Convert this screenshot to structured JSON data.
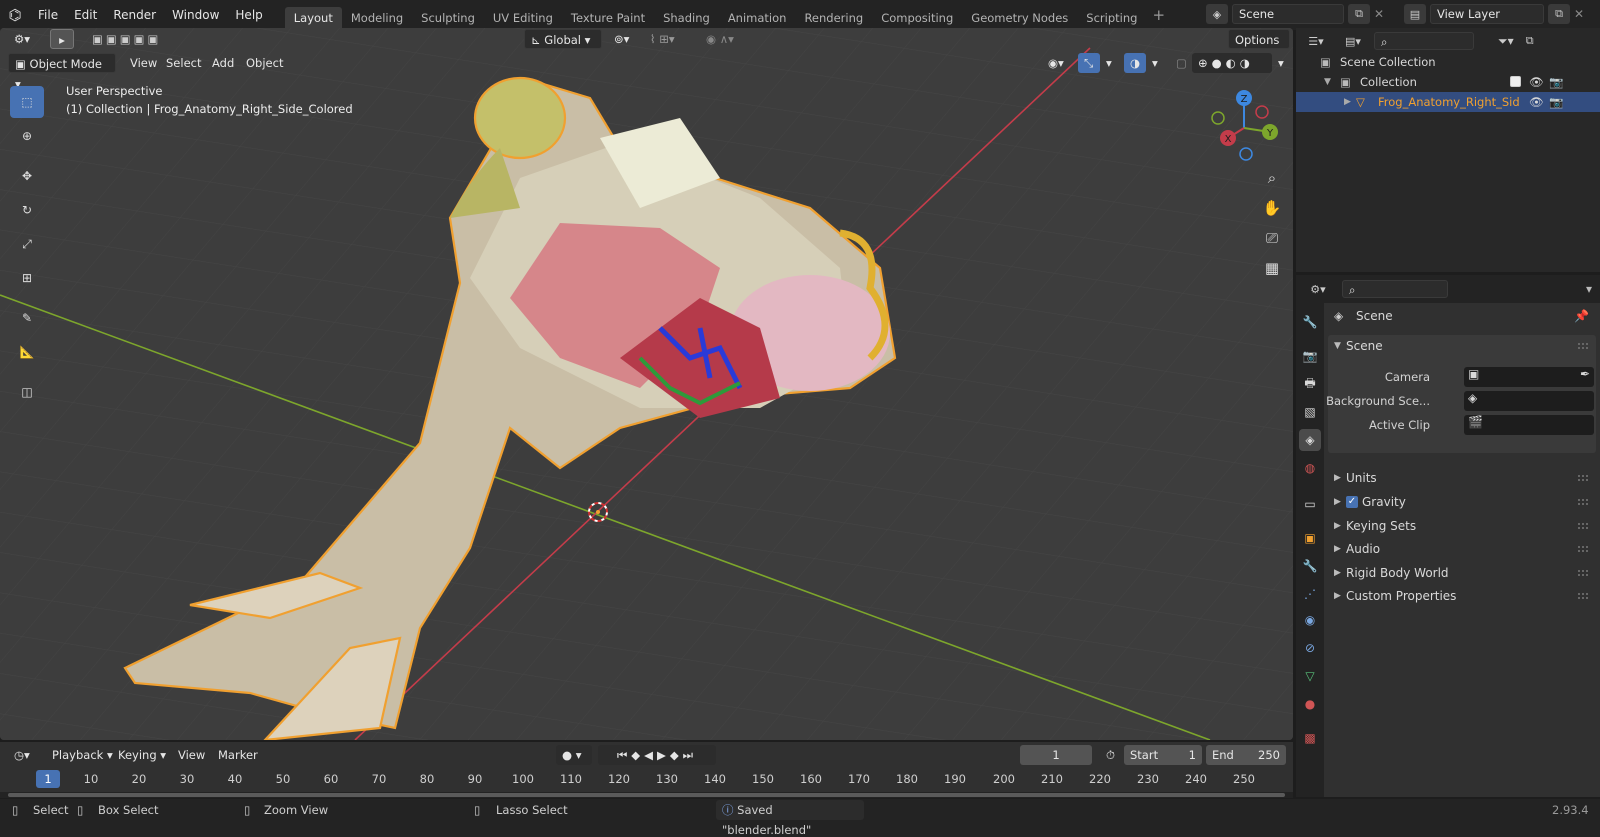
{
  "app": {
    "version": "2.93.4"
  },
  "menu": [
    "File",
    "Edit",
    "Render",
    "Window",
    "Help"
  ],
  "workspaces": [
    "Layout",
    "Modeling",
    "Sculpting",
    "UV Editing",
    "Texture Paint",
    "Shading",
    "Animation",
    "Rendering",
    "Compositing",
    "Geometry Nodes",
    "Scripting"
  ],
  "scene_field": "Scene",
  "view_layer_field": "View Layer",
  "viewport": {
    "mode": "Object Mode",
    "menus": [
      "View",
      "Select",
      "Add",
      "Object"
    ],
    "orientation": "Global",
    "options_label": "Options",
    "overlay_title": "User Perspective",
    "overlay_subtitle": "(1) Collection | Frog_Anatomy_Right_Side_Colored",
    "gizmo": {
      "x": "X",
      "y": "Y",
      "z": "Z"
    }
  },
  "tools": [
    "select-box",
    "cursor",
    "move",
    "rotate",
    "scale",
    "transform",
    "annotate",
    "measure",
    "add-cube"
  ],
  "timeline": {
    "menus": [
      "Playback",
      "Keying",
      "View",
      "Marker"
    ],
    "current_frame": "1",
    "start_label": "Start",
    "start_value": "1",
    "end_label": "End",
    "end_value": "250",
    "ticks": [
      "1",
      "10",
      "20",
      "30",
      "40",
      "50",
      "60",
      "70",
      "80",
      "90",
      "100",
      "110",
      "120",
      "130",
      "140",
      "150",
      "160",
      "170",
      "180",
      "190",
      "200",
      "210",
      "220",
      "230",
      "240",
      "250"
    ]
  },
  "status": {
    "select": "Select",
    "box_select": "Box Select",
    "zoom_view": "Zoom View",
    "lasso_select": "Lasso Select",
    "message": "Saved \"blender.blend\""
  },
  "outliner": {
    "scene_collection": "Scene Collection",
    "collection": "Collection",
    "object": "Frog_Anatomy_Right_Sid"
  },
  "properties": {
    "context": "Scene",
    "panel_title": "Scene",
    "camera_label": "Camera",
    "background_label": "Background Sce...",
    "active_clip_label": "Active Clip",
    "subpanels": [
      "Units",
      "Gravity",
      "Keying Sets",
      "Audio",
      "Rigid Body World",
      "Custom Properties"
    ],
    "gravity_checked": true
  },
  "colors": {
    "accent": "#4772b3",
    "selection_outline": "#f0a030",
    "x_axis": "#c43c4a",
    "y_axis": "#7da62c",
    "z_axis": "#3d88e0"
  }
}
